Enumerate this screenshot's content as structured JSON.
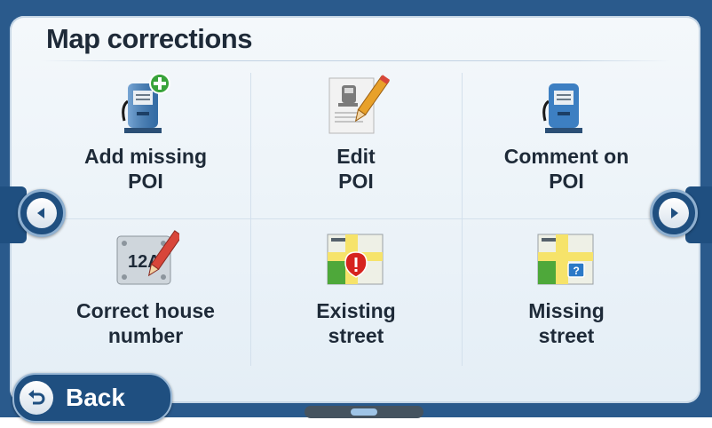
{
  "screen": {
    "title": "Map corrections"
  },
  "items": [
    {
      "line1": "Add missing",
      "line2": "POI",
      "icon": "fuel-pump-add-icon"
    },
    {
      "line1": "Edit",
      "line2": "POI",
      "icon": "fuel-pump-edit-icon"
    },
    {
      "line1": "Comment on",
      "line2": "POI",
      "icon": "fuel-pump-comment-icon"
    },
    {
      "line1": "Correct house",
      "line2": "number",
      "icon": "house-number-edit-icon"
    },
    {
      "line1": "Existing",
      "line2": "street",
      "icon": "map-street-warning-icon"
    },
    {
      "line1": "Missing",
      "line2": "street",
      "icon": "map-street-question-icon"
    }
  ],
  "house_number_icon_text": "12A",
  "footer": {
    "back_label": "Back"
  },
  "nav": {
    "prev_icon": "chevron-left-icon",
    "next_icon": "chevron-right-icon"
  },
  "colors": {
    "frame": "#2a5a8c",
    "button": "#1f4f80",
    "text": "#1e2a38"
  }
}
